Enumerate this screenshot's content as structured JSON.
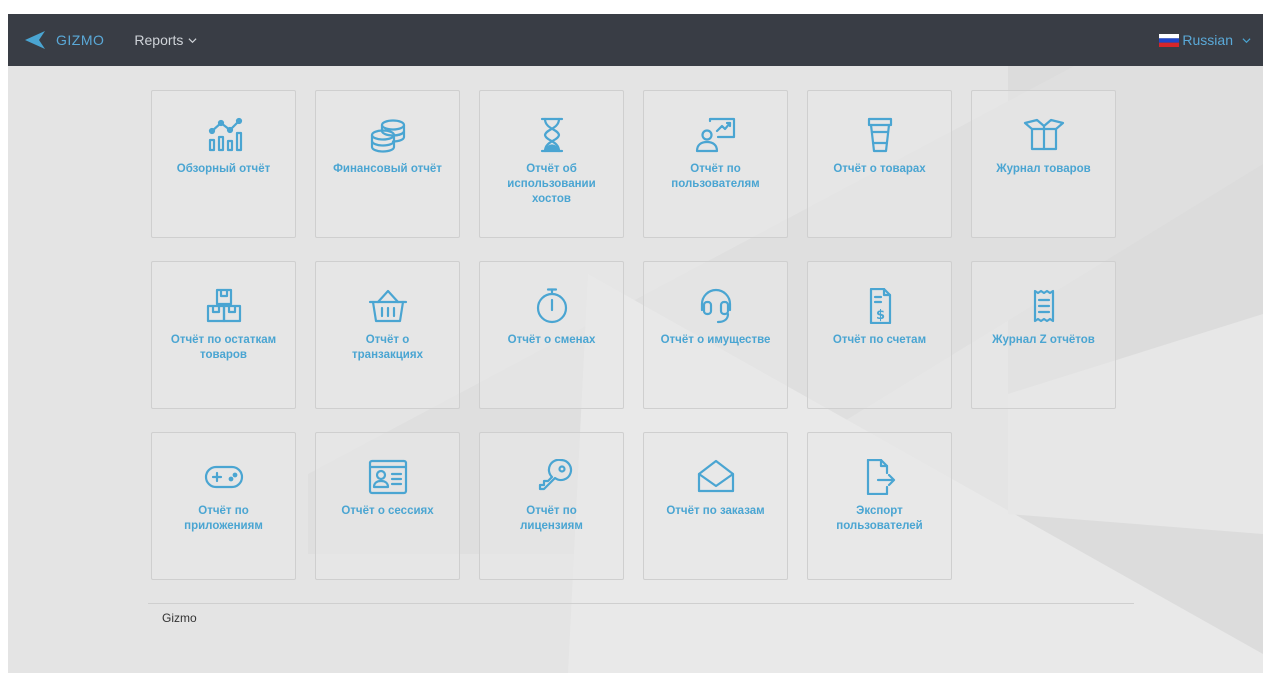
{
  "navbar": {
    "brand": "GIZMO",
    "reports_menu": "Reports",
    "language": "Russian"
  },
  "colors": {
    "navbar_bg": "#393d45",
    "accent": "#4aa5d2",
    "page_bg": "#e4e4e4"
  },
  "tiles": [
    {
      "label": "Обзорный отчёт",
      "icon": "analytics-chart-icon"
    },
    {
      "label": "Финансовый отчёт",
      "icon": "coins-stack-icon"
    },
    {
      "label": "Отчёт об использовании хостов",
      "icon": "hourglass-icon"
    },
    {
      "label": "Отчёт по пользователям",
      "icon": "user-presentation-icon"
    },
    {
      "label": "Отчёт о товарах",
      "icon": "cup-icon"
    },
    {
      "label": "Журнал товаров",
      "icon": "open-box-icon"
    },
    {
      "label": "Отчёт по остаткам товаров",
      "icon": "stacked-boxes-icon"
    },
    {
      "label": "Отчёт о транзакциях",
      "icon": "basket-icon"
    },
    {
      "label": "Отчёт о сменах",
      "icon": "stopwatch-icon"
    },
    {
      "label": "Отчёт о имуществе",
      "icon": "headset-icon"
    },
    {
      "label": "Отчёт по счетам",
      "icon": "invoice-dollar-icon"
    },
    {
      "label": "Журнал Z отчётов",
      "icon": "receipt-icon"
    },
    {
      "label": "Отчёт по приложениям",
      "icon": "gamepad-icon"
    },
    {
      "label": "Отчёт о сессиях",
      "icon": "id-card-icon"
    },
    {
      "label": "Отчёт по лицензиям",
      "icon": "key-icon"
    },
    {
      "label": "Отчёт по заказам",
      "icon": "envelope-open-icon"
    },
    {
      "label": "Экспорт пользователей",
      "icon": "file-export-icon"
    }
  ],
  "footer": {
    "text": "Gizmo"
  }
}
